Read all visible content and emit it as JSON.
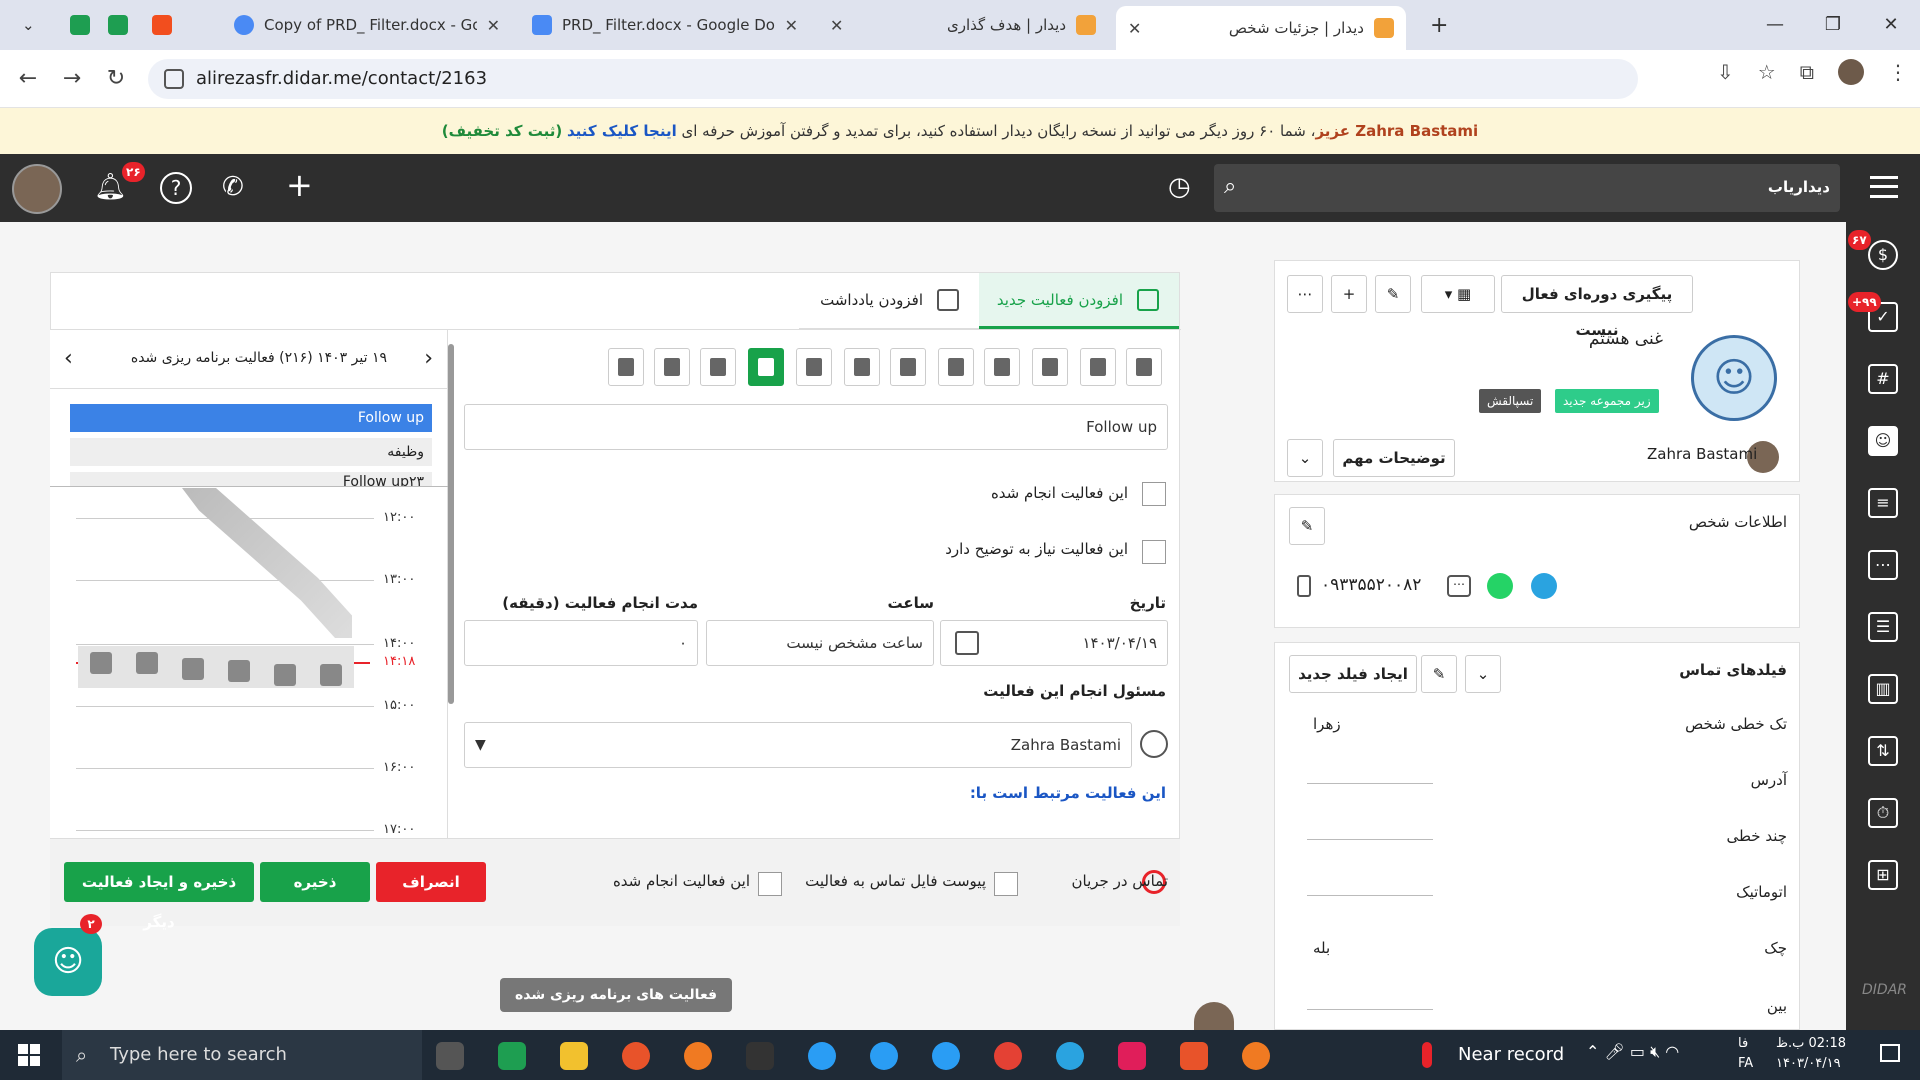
{
  "browser": {
    "tabs": [
      {
        "label": "Copy of PRD_ Filter.docx - Goo",
        "icon_color": "#4a8af4"
      },
      {
        "label": "PRD_ Filter.docx - Google Docs",
        "icon_color": "#4a8af4"
      },
      {
        "label": "دیدار | هدف گذاری",
        "icon_color": "#f2a23a"
      },
      {
        "label": "دیدار | جزئیات شخص",
        "icon_color": "#f2a23a"
      }
    ],
    "url": "alirezasfr.didar.me/contact/2163"
  },
  "banner": {
    "name": "Zahra Bastami عزیز",
    "text": "، شما ۶۰ روز دیگر می توانید از نسخه رایگان دیدار استفاده کنید، برای تمدید و گرفتن آموزش حرفه ای",
    "link": "اینجا کلیک کنید",
    "code": "(ثبت کد تخفیف)"
  },
  "header": {
    "notifications_count": "۲۶",
    "search_label": "دیداریاب"
  },
  "contact": {
    "pipeline_button": "پیگیری دوره‌ای فعال نیست",
    "name": "غنی هستم",
    "tag_subgroup": "زیر مجموعه جدید",
    "tag_owner": "تسپالقش",
    "owner_name": "Zahra Bastami",
    "important_notes": "توضیحات مهم"
  },
  "person_info": {
    "title": "اطلاعات شخص",
    "phone": "۰۹۳۳۵۵۲۰۰۸۲"
  },
  "contact_fields": {
    "title": "فیلدهای تماس",
    "new_field": "ایجاد فیلد جدید",
    "rows": [
      {
        "label": "تک خطی شخص",
        "value": "زهرا"
      },
      {
        "label": "آدرس",
        "value": ""
      },
      {
        "label": "چند خطی",
        "value": ""
      },
      {
        "label": "اتوماتیک",
        "value": ""
      },
      {
        "label": "چک",
        "value": "بله"
      },
      {
        "label": "بین",
        "value": ""
      }
    ]
  },
  "activity": {
    "tab_new": "افزودن فعالیت جدید",
    "tab_note": "افزودن یادداشت",
    "title_value": "Follow up",
    "done_label": "این فعالیت انجام شده",
    "needs_desc_label": "این فعالیت نیاز به توضیح دارد",
    "date_label": "تاریخ",
    "date_value": "۱۴۰۳/۰۴/۱۹",
    "time_label": "ساعت",
    "time_value": "ساعت مشخص نیست",
    "duration_label": "مدت انجام فعالیت (دقیقه)",
    "duration_value": "۰",
    "owner_label": "مسئول انجام این فعالیت",
    "owner_value": "Zahra Bastami",
    "related_label": "این فعالیت مرتبط است با:"
  },
  "footer_bar": {
    "call_label": "تماس در جریان",
    "attach_label": "پیوست فایل تماس به فعالیت",
    "done_label": "این فعالیت انجام شده",
    "cancel": "انصراف",
    "save": "ذخیره",
    "save_new": "ذخیره و ایجاد فعالیت دیگر"
  },
  "calendar": {
    "header": "۱۹ تیر ۱۴۰۳   (۲۱۶) فعالیت برنامه ریزی شده",
    "list": [
      "Follow up",
      "وظیفه",
      "Follow up۲۳"
    ],
    "times": [
      "۱۲:۰۰",
      "۱۳:۰۰",
      "۱۴:۰۰",
      "۱۴:۱۸",
      "۱۵:۰۰",
      "۱۶:۰۰",
      "۱۷:۰۰"
    ]
  },
  "planned_button": "فعالیت های برنامه ریزی شده",
  "chat_badge": "۲",
  "rightbar_badges": {
    "money": "۶۷",
    "tasks": "+۹۹"
  },
  "taskbar": {
    "search_placeholder": "Type here to search",
    "weather": "Near record",
    "time": "02:18 ب.ظ",
    "date": "۱۴۰۳/۰۴/۱۹",
    "lang": "FA",
    "lang2": "فا"
  },
  "colors": {
    "green": "#18a24a",
    "red": "#e8232a",
    "blue": "#3b82e6",
    "dark": "#2e2e2e"
  }
}
